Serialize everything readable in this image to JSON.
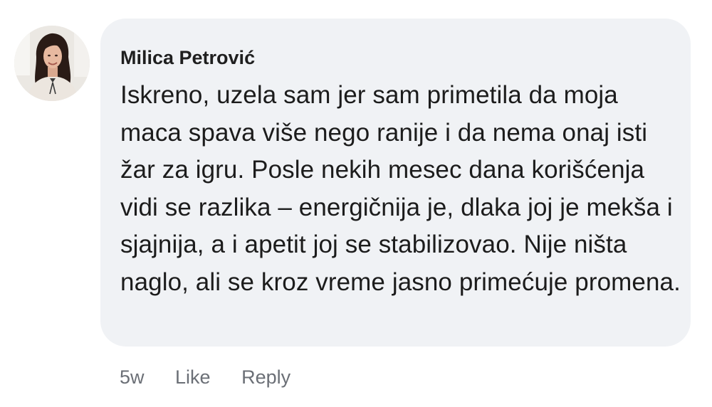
{
  "comment": {
    "author": "Milica Petrović",
    "text": "Iskreno, uzela sam jer sam primetila da moja maca spava više nego ranije i da nema onaj isti žar za igru. Posle nekih mesec dana korišćenja vidi se razlika – energičnija je, dlaka joj je mekša i sjajnija, a i apetit joj se stabilizovao. Nije ništa naglo, ali se kroz vreme jasno primećuje promena.",
    "timestamp": "5w",
    "like_label": "Like",
    "reply_label": "Reply"
  },
  "avatar": {
    "icon": "profile-photo"
  }
}
